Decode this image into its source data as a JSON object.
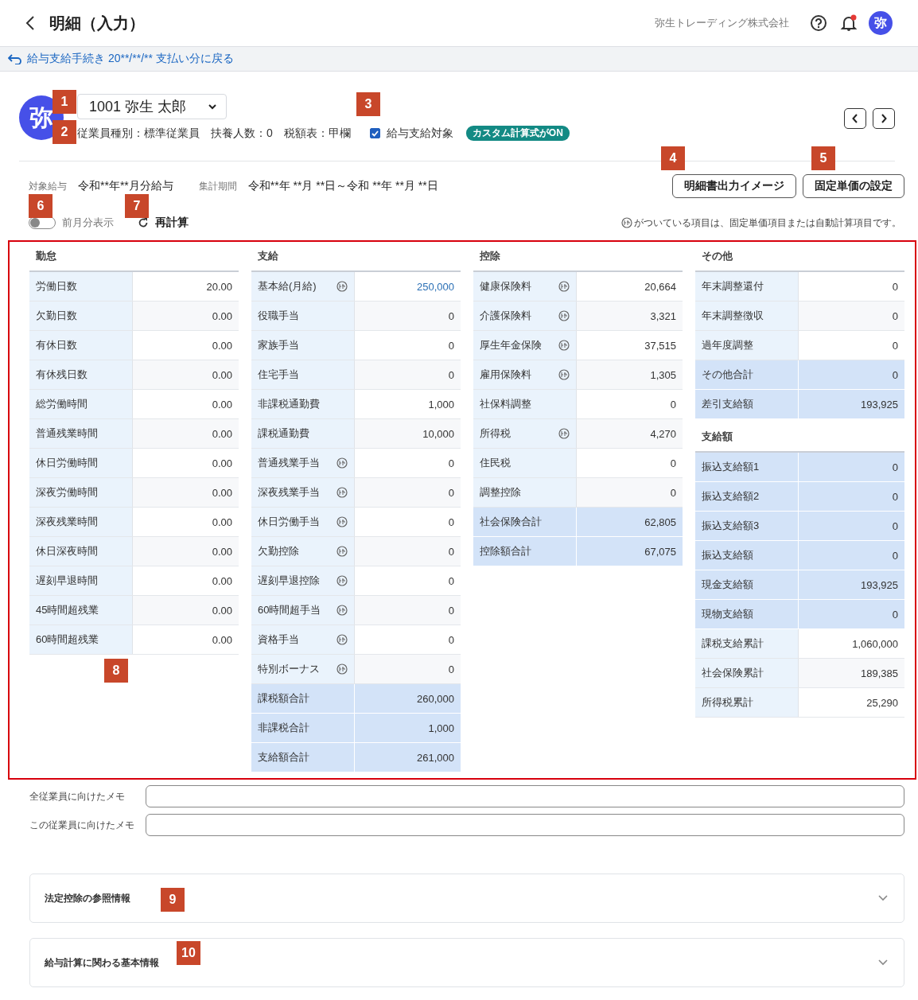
{
  "header": {
    "title": "明細（入力）",
    "company": "弥生トレーディング株式会社",
    "notification": true,
    "avatar": "弥"
  },
  "back_link": "給与支給手続き 20**/**/** 支払い分に戻る",
  "employee": {
    "avatar": "弥",
    "name": "1001 弥生 太郎",
    "details": [
      "従業員種別：標準従業員",
      "扶養人数：0",
      "税額表：甲欄"
    ],
    "pay_target": {
      "label": "給与支給対象",
      "checked": true
    },
    "badge": "カスタム計算式がON"
  },
  "period": {
    "target_label": "対象給与",
    "target_value": "令和**年**月分給与",
    "range_label": "集計期間",
    "range_value": "令和**年 **月 **日～令和 **年 **月 **日"
  },
  "buttons": [
    "明細書出力イメージ",
    "固定単価の設定"
  ],
  "previous_month": {
    "label": "前月分表示",
    "on": false
  },
  "recalc": "再計算",
  "note": "がついている項目は、固定単価項目または自動計算項目です。",
  "columns": [
    {
      "sections": [
        {
          "title": "勤怠",
          "rows": [
            {
              "label": "労働日数",
              "value": "20.00",
              "calc": false,
              "kind": "item"
            },
            {
              "label": "欠勤日数",
              "value": "0.00",
              "calc": false,
              "kind": "item"
            },
            {
              "label": "有休日数",
              "value": "0.00",
              "calc": false,
              "kind": "item"
            },
            {
              "label": "有休残日数",
              "value": "0.00",
              "calc": false,
              "kind": "item"
            },
            {
              "label": "総労働時間",
              "value": "0.00",
              "calc": false,
              "kind": "item"
            },
            {
              "label": "普通残業時間",
              "value": "0.00",
              "calc": false,
              "kind": "item"
            },
            {
              "label": "休日労働時間",
              "value": "0.00",
              "calc": false,
              "kind": "item"
            },
            {
              "label": "深夜労働時間",
              "value": "0.00",
              "calc": false,
              "kind": "item"
            },
            {
              "label": "深夜残業時間",
              "value": "0.00",
              "calc": false,
              "kind": "item"
            },
            {
              "label": "休日深夜時間",
              "value": "0.00",
              "calc": false,
              "kind": "item"
            },
            {
              "label": "遅刻早退時間",
              "value": "0.00",
              "calc": false,
              "kind": "item"
            },
            {
              "label": "45時間超残業",
              "value": "0.00",
              "calc": false,
              "kind": "item"
            },
            {
              "label": "60時間超残業",
              "value": "0.00",
              "calc": false,
              "kind": "item"
            }
          ]
        }
      ]
    },
    {
      "sections": [
        {
          "title": "支給",
          "rows": [
            {
              "label": "基本給(月給)",
              "value": "250,000",
              "calc": true,
              "kind": "accent"
            },
            {
              "label": "役職手当",
              "value": "0",
              "calc": false,
              "kind": "item"
            },
            {
              "label": "家族手当",
              "value": "0",
              "calc": false,
              "kind": "item"
            },
            {
              "label": "住宅手当",
              "value": "0",
              "calc": false,
              "kind": "item"
            },
            {
              "label": "非課税通勤費",
              "value": "1,000",
              "calc": false,
              "kind": "item"
            },
            {
              "label": "課税通勤費",
              "value": "10,000",
              "calc": false,
              "kind": "item"
            },
            {
              "label": "普通残業手当",
              "value": "0",
              "calc": true,
              "kind": "item"
            },
            {
              "label": "深夜残業手当",
              "value": "0",
              "calc": true,
              "kind": "item"
            },
            {
              "label": "休日労働手当",
              "value": "0",
              "calc": true,
              "kind": "item"
            },
            {
              "label": "欠勤控除",
              "value": "0",
              "calc": true,
              "kind": "item"
            },
            {
              "label": "遅刻早退控除",
              "value": "0",
              "calc": true,
              "kind": "item"
            },
            {
              "label": "60時間超手当",
              "value": "0",
              "calc": true,
              "kind": "item"
            },
            {
              "label": "資格手当",
              "value": "0",
              "calc": true,
              "kind": "item"
            },
            {
              "label": "特別ボーナス",
              "value": "0",
              "calc": true,
              "kind": "item"
            },
            {
              "label": "課税額合計",
              "value": "260,000",
              "calc": false,
              "kind": "total"
            },
            {
              "label": "非課税合計",
              "value": "1,000",
              "calc": false,
              "kind": "total"
            },
            {
              "label": "支給額合計",
              "value": "261,000",
              "calc": false,
              "kind": "total"
            }
          ]
        }
      ]
    },
    {
      "sections": [
        {
          "title": "控除",
          "rows": [
            {
              "label": "健康保険料",
              "value": "20,664",
              "calc": true,
              "kind": "item"
            },
            {
              "label": "介護保険料",
              "value": "3,321",
              "calc": true,
              "kind": "item"
            },
            {
              "label": "厚生年金保険",
              "value": "37,515",
              "calc": true,
              "kind": "item"
            },
            {
              "label": "雇用保険料",
              "value": "1,305",
              "calc": true,
              "kind": "item"
            },
            {
              "label": "社保料調整",
              "value": "0",
              "calc": false,
              "kind": "item"
            },
            {
              "label": "所得税",
              "value": "4,270",
              "calc": true,
              "kind": "item"
            },
            {
              "label": "住民税",
              "value": "0",
              "calc": false,
              "kind": "item"
            },
            {
              "label": "調整控除",
              "value": "0",
              "calc": false,
              "kind": "item"
            },
            {
              "label": "社会保険合計",
              "value": "62,805",
              "calc": false,
              "kind": "total"
            },
            {
              "label": "控除額合計",
              "value": "67,075",
              "calc": false,
              "kind": "total"
            }
          ]
        }
      ]
    },
    {
      "sections": [
        {
          "title": "その他",
          "rows": [
            {
              "label": "年末調整還付",
              "value": "0",
              "calc": false,
              "kind": "item"
            },
            {
              "label": "年末調整徴収",
              "value": "0",
              "calc": false,
              "kind": "item"
            },
            {
              "label": "過年度調整",
              "value": "0",
              "calc": false,
              "kind": "item"
            },
            {
              "label": "その他合計",
              "value": "0",
              "calc": false,
              "kind": "total"
            },
            {
              "label": "差引支給額",
              "value": "193,925",
              "calc": false,
              "kind": "total"
            }
          ]
        },
        {
          "title": "支給額",
          "rows": [
            {
              "label": "振込支給額1",
              "value": "0",
              "calc": false,
              "kind": "total"
            },
            {
              "label": "振込支給額2",
              "value": "0",
              "calc": false,
              "kind": "total"
            },
            {
              "label": "振込支給額3",
              "value": "0",
              "calc": false,
              "kind": "total"
            },
            {
              "label": "振込支給額",
              "value": "0",
              "calc": false,
              "kind": "total"
            },
            {
              "label": "現金支給額",
              "value": "193,925",
              "calc": false,
              "kind": "total"
            },
            {
              "label": "現物支給額",
              "value": "0",
              "calc": false,
              "kind": "total"
            },
            {
              "label": "課税支給累計",
              "value": "1,060,000",
              "calc": false,
              "kind": "item"
            },
            {
              "label": "社会保険累計",
              "value": "189,385",
              "calc": false,
              "kind": "item"
            },
            {
              "label": "所得税累計",
              "value": "25,290",
              "calc": false,
              "kind": "item"
            }
          ]
        }
      ]
    }
  ],
  "memos": [
    {
      "label": "全従業員に向けたメモ"
    },
    {
      "label": "この従業員に向けたメモ"
    }
  ],
  "accordions": [
    {
      "title": "法定控除の参照情報",
      "expanded": false
    },
    {
      "title": "給与計算に関わる基本情報",
      "expanded": false
    }
  ],
  "callouts": [
    "1",
    "2",
    "3",
    "4",
    "5",
    "6",
    "7",
    "8",
    "9",
    "10"
  ]
}
